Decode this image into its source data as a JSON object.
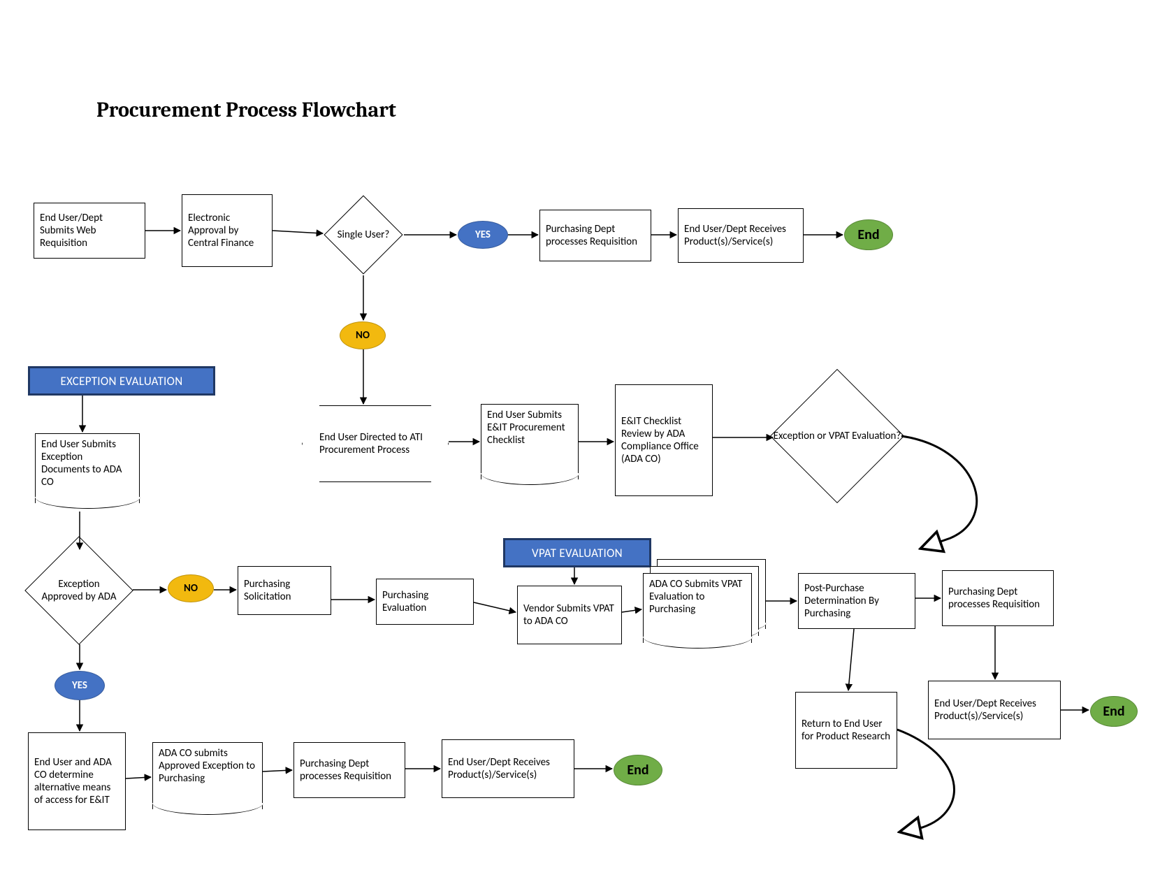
{
  "title": "Procurement Process Flowchart",
  "row1": {
    "submitWeb": "End User/Dept Submits Web Requisition",
    "electronicApproval": "Electronic Approval by Central Finance",
    "singleUser": "Single User?",
    "yes": "YES",
    "purchasingProcesses": "Purchasing Dept processes Requisition",
    "receives": "End User/Dept Receives Product(s)/Service(s)",
    "end": "End"
  },
  "no": "NO",
  "row2": {
    "atiProcess": "End User Directed to ATI Procurement Process",
    "eitChecklist": "End User Submits E&IT Procurement Checklist",
    "checklistReview": "E&IT Checklist Review by ADA Compliance Office (ADA CO)",
    "exceptionOrVpat": "Exception or VPAT Evaluation?"
  },
  "exceptionBanner": "EXCEPTION EVALUATION",
  "exceptionPath": {
    "submitDocs": "End User Submits Exception Documents to ADA CO",
    "approved": "Exception Approved by ADA",
    "no2": "NO",
    "solicitation": "Purchasing Solicitation",
    "evaluation": "Purchasing Evaluation",
    "yes2": "YES",
    "determineAlt": "End User and ADA CO determine alternative means of access for E&IT",
    "adaSubmits": "ADA CO submits Approved Exception to Purchasing",
    "deptProcesses": "Purchasing Dept processes Requisition",
    "receives2": "End User/Dept Receives Product(s)/Service(s)",
    "end2": "End"
  },
  "vpatBanner": "VPAT EVALUATION",
  "vpatPath": {
    "vendorSubmits": "Vendor Submits VPAT to ADA CO",
    "adaSubmitsVpat": "ADA CO Submits VPAT Evaluation to Purchasing",
    "postPurchase": "Post-Purchase Determination By Purchasing",
    "returnUser": "Return to End User for Product Research",
    "deptProcesses2": "Purchasing Dept processes Requisition",
    "receives3": "End User/Dept Receives Product(s)/Service(s)",
    "end3": "End"
  }
}
